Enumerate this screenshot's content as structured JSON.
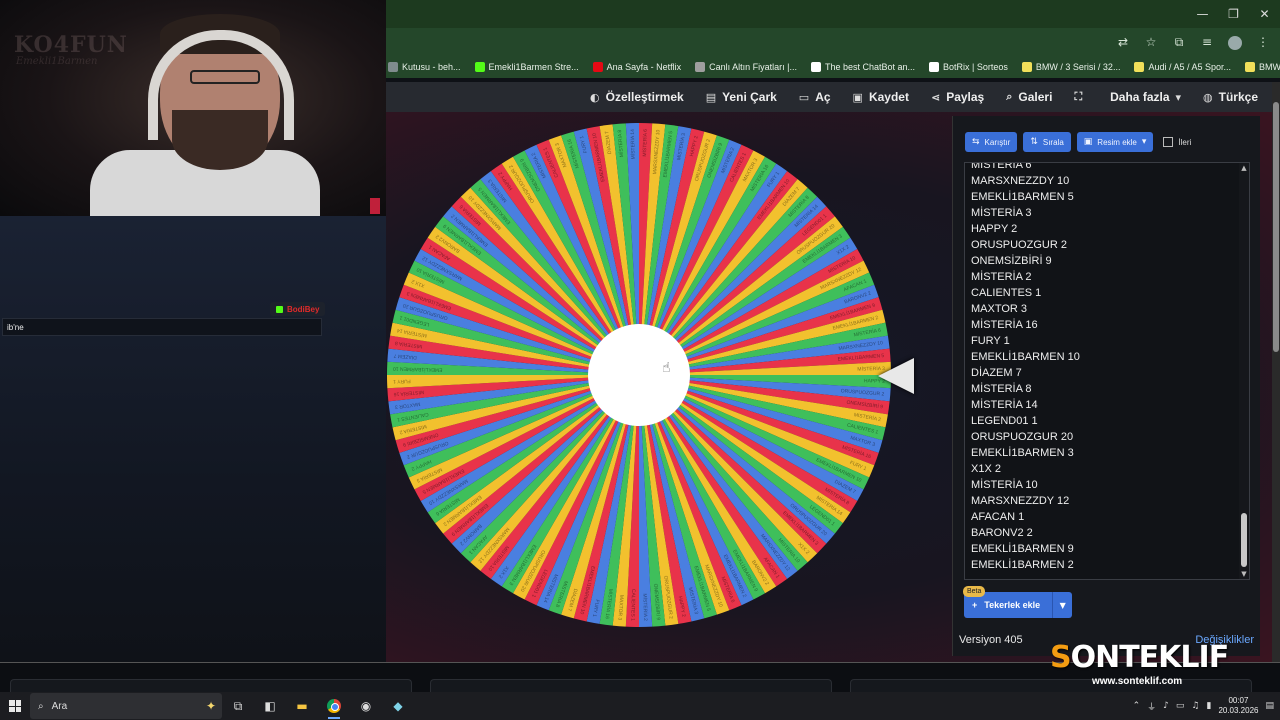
{
  "browser": {
    "window_controls": [
      "minimize-icon",
      "restore-icon",
      "close-icon"
    ],
    "toolbar_icons": [
      "translate-icon",
      "star-icon",
      "extensions-icon",
      "media-icon",
      "profile-avatar",
      "menu-icon"
    ],
    "bookmarks": [
      {
        "label": "Kutusu - beh...",
        "color": "#7f8c8d"
      },
      {
        "label": "Emekli1Barmen Stre...",
        "color": "#53fc18"
      },
      {
        "label": "Ana Sayfa - Netflix",
        "color": "#e50914"
      },
      {
        "label": "Canlı Altın Fiyatları |...",
        "color": "#9e9e9e"
      },
      {
        "label": "The best ChatBot an...",
        "color": "#ffffff"
      },
      {
        "label": "BotRix | Sorteos",
        "color": "#ffffff"
      },
      {
        "label": "BMW / 3 Serisi / 32...",
        "color": "#f1e05a"
      },
      {
        "label": "Audi / A5 / A5 Spor...",
        "color": "#f1e05a"
      },
      {
        "label": "BMW / 3 Serisi / 32...",
        "color": "#f1e05a"
      }
    ]
  },
  "nav": {
    "items": [
      {
        "label": "Özelleştirmek",
        "icon": "palette-icon",
        "glyph": "◐"
      },
      {
        "label": "Yeni Çark",
        "icon": "new-file-icon",
        "glyph": "▤"
      },
      {
        "label": "Aç",
        "icon": "folder-icon",
        "glyph": "▭"
      },
      {
        "label": "Kaydet",
        "icon": "save-icon",
        "glyph": "▣"
      },
      {
        "label": "Paylaş",
        "icon": "share-icon",
        "glyph": "⋖"
      },
      {
        "label": "Galeri",
        "icon": "search-icon",
        "glyph": "⌕"
      },
      {
        "label": "",
        "icon": "fullscreen-icon",
        "glyph": "⛶"
      },
      {
        "label": "Daha fazla",
        "icon": "chevron-down-icon",
        "glyph": "▾"
      },
      {
        "label": "Türkçe",
        "icon": "globe-icon",
        "glyph": "◍"
      }
    ]
  },
  "stream": {
    "cam_text": "KO4FUN",
    "cam_sub": "Emekli1Barmen",
    "chat_user": "BodiBey",
    "chat_message": "ib'ne"
  },
  "wheel": {
    "slice_colors": [
      "#e8334a",
      "#f2c12e",
      "#3fbf5b",
      "#4a7fe0"
    ],
    "slice_count": 120
  },
  "panel": {
    "shuffle_label": "Karıştır",
    "sort_label": "Sırala",
    "add_image_label": "Resim ekle",
    "advanced_label": "İleri",
    "entries": [
      "MİSTERİA 6",
      "MARSXNEZZDY 10",
      "EMEKLİ1BARMEN 5",
      "MİSTERİA 3",
      "HAPPY 2",
      "ORUSPUOZGUR 2",
      "ONEMSİZBİRİ 9",
      "MİSTERİA 2",
      "CALIENTES 1",
      "MAXTOR 3",
      "MİSTERİA 16",
      "FURY 1",
      "EMEKLİ1BARMEN 10",
      "DİAZEM 7",
      "MİSTERİA 8",
      "MİSTERİA 14",
      "LEGEND01 1",
      "ORUSPUOZGUR 20",
      "EMEKLİ1BARMEN 3",
      "X1X 2",
      "MİSTERİA 10",
      "MARSXNEZZDY 12",
      "AFACAN 1",
      "BARONV2 2",
      "EMEKLİ1BARMEN 9",
      "EMEKLİ1BARMEN 2"
    ],
    "beta_label": "Beta",
    "add_wheels_label": "Tekerlek ekle",
    "version": "Versiyon 405",
    "changes": "Değişiklikler"
  },
  "overlay": {
    "logo_first": "S",
    "logo_rest": "ONTEKLIF",
    "url": "www.sonteklif.com"
  },
  "taskbar": {
    "search_placeholder": "Ara",
    "time": "00:07",
    "date": "20.03.2026"
  }
}
